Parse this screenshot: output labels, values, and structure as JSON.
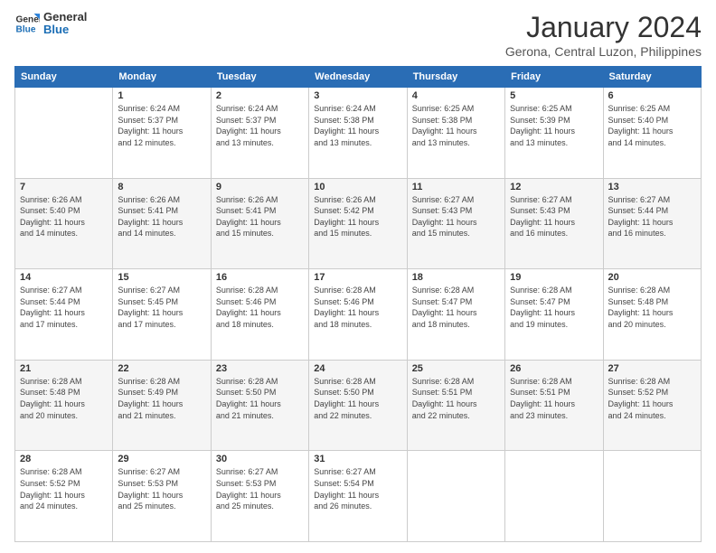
{
  "logo": {
    "line1": "General",
    "line2": "Blue"
  },
  "title": "January 2024",
  "subtitle": "Gerona, Central Luzon, Philippines",
  "days_header": [
    "Sunday",
    "Monday",
    "Tuesday",
    "Wednesday",
    "Thursday",
    "Friday",
    "Saturday"
  ],
  "weeks": [
    [
      {
        "day": "",
        "info": ""
      },
      {
        "day": "1",
        "info": "Sunrise: 6:24 AM\nSunset: 5:37 PM\nDaylight: 11 hours\nand 12 minutes."
      },
      {
        "day": "2",
        "info": "Sunrise: 6:24 AM\nSunset: 5:37 PM\nDaylight: 11 hours\nand 13 minutes."
      },
      {
        "day": "3",
        "info": "Sunrise: 6:24 AM\nSunset: 5:38 PM\nDaylight: 11 hours\nand 13 minutes."
      },
      {
        "day": "4",
        "info": "Sunrise: 6:25 AM\nSunset: 5:38 PM\nDaylight: 11 hours\nand 13 minutes."
      },
      {
        "day": "5",
        "info": "Sunrise: 6:25 AM\nSunset: 5:39 PM\nDaylight: 11 hours\nand 13 minutes."
      },
      {
        "day": "6",
        "info": "Sunrise: 6:25 AM\nSunset: 5:40 PM\nDaylight: 11 hours\nand 14 minutes."
      }
    ],
    [
      {
        "day": "7",
        "info": "Sunrise: 6:26 AM\nSunset: 5:40 PM\nDaylight: 11 hours\nand 14 minutes."
      },
      {
        "day": "8",
        "info": "Sunrise: 6:26 AM\nSunset: 5:41 PM\nDaylight: 11 hours\nand 14 minutes."
      },
      {
        "day": "9",
        "info": "Sunrise: 6:26 AM\nSunset: 5:41 PM\nDaylight: 11 hours\nand 15 minutes."
      },
      {
        "day": "10",
        "info": "Sunrise: 6:26 AM\nSunset: 5:42 PM\nDaylight: 11 hours\nand 15 minutes."
      },
      {
        "day": "11",
        "info": "Sunrise: 6:27 AM\nSunset: 5:43 PM\nDaylight: 11 hours\nand 15 minutes."
      },
      {
        "day": "12",
        "info": "Sunrise: 6:27 AM\nSunset: 5:43 PM\nDaylight: 11 hours\nand 16 minutes."
      },
      {
        "day": "13",
        "info": "Sunrise: 6:27 AM\nSunset: 5:44 PM\nDaylight: 11 hours\nand 16 minutes."
      }
    ],
    [
      {
        "day": "14",
        "info": "Sunrise: 6:27 AM\nSunset: 5:44 PM\nDaylight: 11 hours\nand 17 minutes."
      },
      {
        "day": "15",
        "info": "Sunrise: 6:27 AM\nSunset: 5:45 PM\nDaylight: 11 hours\nand 17 minutes."
      },
      {
        "day": "16",
        "info": "Sunrise: 6:28 AM\nSunset: 5:46 PM\nDaylight: 11 hours\nand 18 minutes."
      },
      {
        "day": "17",
        "info": "Sunrise: 6:28 AM\nSunset: 5:46 PM\nDaylight: 11 hours\nand 18 minutes."
      },
      {
        "day": "18",
        "info": "Sunrise: 6:28 AM\nSunset: 5:47 PM\nDaylight: 11 hours\nand 18 minutes."
      },
      {
        "day": "19",
        "info": "Sunrise: 6:28 AM\nSunset: 5:47 PM\nDaylight: 11 hours\nand 19 minutes."
      },
      {
        "day": "20",
        "info": "Sunrise: 6:28 AM\nSunset: 5:48 PM\nDaylight: 11 hours\nand 20 minutes."
      }
    ],
    [
      {
        "day": "21",
        "info": "Sunrise: 6:28 AM\nSunset: 5:48 PM\nDaylight: 11 hours\nand 20 minutes."
      },
      {
        "day": "22",
        "info": "Sunrise: 6:28 AM\nSunset: 5:49 PM\nDaylight: 11 hours\nand 21 minutes."
      },
      {
        "day": "23",
        "info": "Sunrise: 6:28 AM\nSunset: 5:50 PM\nDaylight: 11 hours\nand 21 minutes."
      },
      {
        "day": "24",
        "info": "Sunrise: 6:28 AM\nSunset: 5:50 PM\nDaylight: 11 hours\nand 22 minutes."
      },
      {
        "day": "25",
        "info": "Sunrise: 6:28 AM\nSunset: 5:51 PM\nDaylight: 11 hours\nand 22 minutes."
      },
      {
        "day": "26",
        "info": "Sunrise: 6:28 AM\nSunset: 5:51 PM\nDaylight: 11 hours\nand 23 minutes."
      },
      {
        "day": "27",
        "info": "Sunrise: 6:28 AM\nSunset: 5:52 PM\nDaylight: 11 hours\nand 24 minutes."
      }
    ],
    [
      {
        "day": "28",
        "info": "Sunrise: 6:28 AM\nSunset: 5:52 PM\nDaylight: 11 hours\nand 24 minutes."
      },
      {
        "day": "29",
        "info": "Sunrise: 6:27 AM\nSunset: 5:53 PM\nDaylight: 11 hours\nand 25 minutes."
      },
      {
        "day": "30",
        "info": "Sunrise: 6:27 AM\nSunset: 5:53 PM\nDaylight: 11 hours\nand 25 minutes."
      },
      {
        "day": "31",
        "info": "Sunrise: 6:27 AM\nSunset: 5:54 PM\nDaylight: 11 hours\nand 26 minutes."
      },
      {
        "day": "",
        "info": ""
      },
      {
        "day": "",
        "info": ""
      },
      {
        "day": "",
        "info": ""
      }
    ]
  ]
}
